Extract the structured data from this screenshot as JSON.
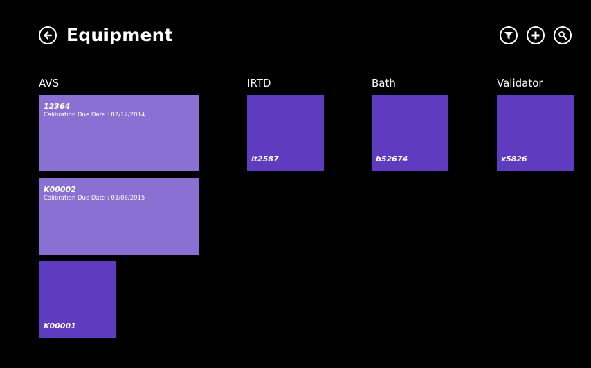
{
  "header": {
    "title": "Equipment",
    "back_icon": "back-arrow-icon",
    "commands": [
      {
        "name": "filter",
        "icon": "filter-icon"
      },
      {
        "name": "add",
        "icon": "plus-icon"
      },
      {
        "name": "search",
        "icon": "search-icon"
      }
    ]
  },
  "colors": {
    "background": "#000000",
    "tile_wide": "#8a70d2",
    "tile_square": "#5f3bbf",
    "text": "#ffffff"
  },
  "groups": {
    "avs": {
      "label": "AVS",
      "tiles": [
        {
          "id": "12364",
          "subtitle": "Calibration Due Date : 02/12/2014"
        },
        {
          "id": "K00002",
          "subtitle": "Calibration Due Date : 03/08/2015"
        },
        {
          "id": "K00001"
        }
      ]
    },
    "irtd": {
      "label": "IRTD",
      "tiles": [
        {
          "id": "it2587"
        }
      ]
    },
    "bath": {
      "label": "Bath",
      "tiles": [
        {
          "id": "b52674"
        }
      ]
    },
    "validator": {
      "label": "Validator",
      "tiles": [
        {
          "id": "x5826"
        }
      ]
    }
  }
}
